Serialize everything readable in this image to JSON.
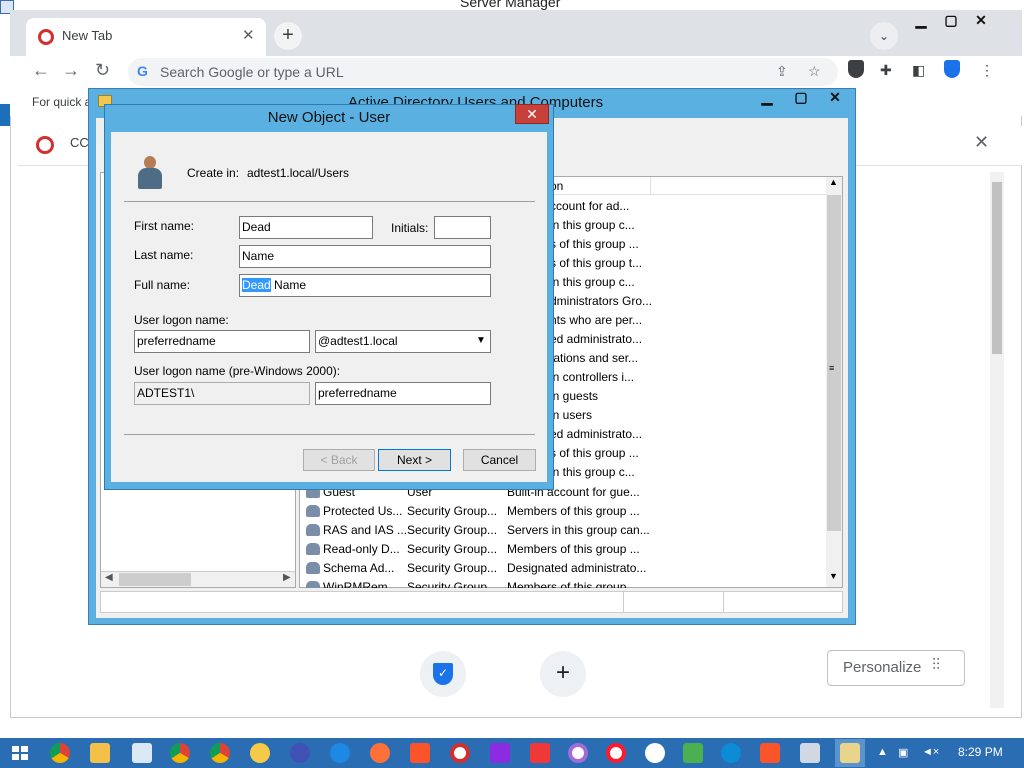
{
  "server_manager": {
    "title": "Server Manager"
  },
  "browser": {
    "tab_title": "New Tab",
    "tab_close": "✕",
    "new_tab": "+",
    "tab_search": "⌄",
    "window_controls": [
      "▁",
      "▢",
      "✕"
    ],
    "nav": {
      "back": "←",
      "forward": "→",
      "reload": "↻"
    },
    "omnibox_placeholder": "Search Google or type a URL",
    "bookmarks_text": "For quick a",
    "infobar_text": "CC",
    "infobar_close": "✕",
    "personalize_label": "Personalize",
    "plus_shortcut": "+"
  },
  "aduc": {
    "title": "Active Directory Users and Computers",
    "window_controls": [
      "▁",
      "▢",
      "✕"
    ],
    "column_header_partial": "on",
    "visible_partial_descriptions": [
      "ccount for ad...",
      "in this group c...",
      "s of this group ...",
      "s of this group t...",
      "in this group c...",
      "dministrators Gro...",
      "nts who are per...",
      "ed administrato...",
      "tations and ser...",
      "in controllers i...",
      "in guests",
      "in users",
      "ed administrato...",
      "s of this group ...",
      "in this group c..."
    ],
    "rows": [
      {
        "name": "Guest",
        "type": "User",
        "description": "Built-in account for gue..."
      },
      {
        "name": "Protected Us...",
        "type": "Security Group...",
        "description": "Members of this group ..."
      },
      {
        "name": "RAS and IAS ...",
        "type": "Security Group...",
        "description": "Servers in this group can..."
      },
      {
        "name": "Read-only D...",
        "type": "Security Group...",
        "description": "Members of this group ..."
      },
      {
        "name": "Schema Ad...",
        "type": "Security Group...",
        "description": "Designated administrato..."
      },
      {
        "name": "WinRMRem...",
        "type": "Security Group...",
        "description": "Members of this group ..."
      }
    ]
  },
  "dialog": {
    "title": "New Object - User",
    "close": "✕",
    "create_in_label": "Create in:",
    "create_in_value": "adtest1.local/Users",
    "first_name_label": "First name:",
    "first_name_value": "Dead",
    "initials_label": "Initials:",
    "initials_value": "",
    "last_name_label": "Last name:",
    "last_name_value": "Name",
    "full_name_label": "Full name:",
    "full_name_selected": "Dead",
    "full_name_rest": " Name",
    "logon_label": "User logon name:",
    "logon_value": "preferredname",
    "domain_value": "@adtest1.local",
    "pre2000_label": "User logon name (pre-Windows 2000):",
    "pre2000_domain": "ADTEST1\\",
    "pre2000_value": "preferredname",
    "back_button": "< Back",
    "next_button": "Next >",
    "cancel_button": "Cancel"
  },
  "taskbar": {
    "clock": "8:29 PM"
  },
  "colors": {
    "window_frame": "#5ab1e1",
    "taskbar": "#2a6db2",
    "selection": "#3399ff",
    "close_red": "#c7403a"
  }
}
